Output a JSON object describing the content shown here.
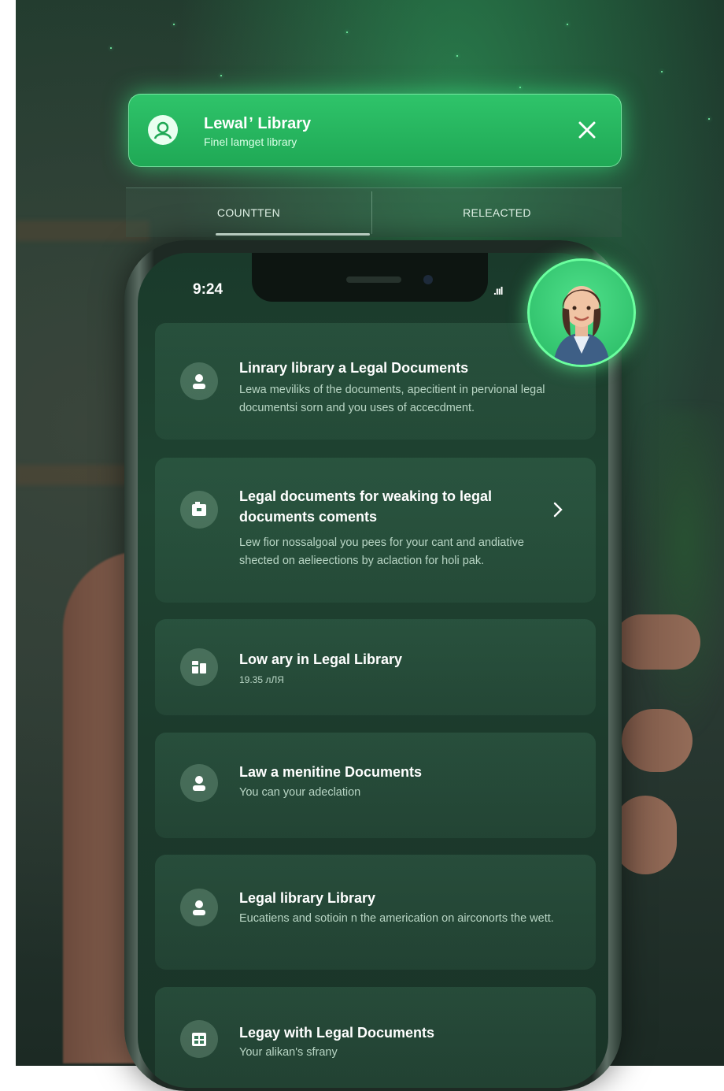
{
  "banner": {
    "title": "Lewal ʼ Library",
    "subtitle": "Finel lamget library",
    "icon": "user-icon",
    "close_icon": "close-icon"
  },
  "tabs": [
    {
      "label": "COUNTTEN",
      "active": true
    },
    {
      "label": "RELEACTED",
      "active": false
    }
  ],
  "status_bar": {
    "time": "9:24",
    "signal": ".ııl"
  },
  "cards": [
    {
      "title": "Linrary library a Legal Documents",
      "description": "Lewa meviliks of the documents, apecitient in pervional legal documentsi sorn and you uses of accecdment.",
      "icon": "person-icon"
    },
    {
      "title": "Legal documents for weaking to legal documents coments",
      "description": "Lew fior nossalgoal you pees for your cant and andiative shected on aelieections by aclaction for holi pak.",
      "icon": "folder-icon",
      "has_chevron": true
    },
    {
      "title": "Low ary in Legal Library",
      "description": "19.35 лЛЯ",
      "icon": "books-icon"
    },
    {
      "title": "Law a menitine Documents",
      "description": "You can your adeclation",
      "icon": "person-icon"
    },
    {
      "title": "Legal library Library",
      "description": "Eucatiens and sotioin n the americation on airconorts the wett.",
      "icon": "person-icon"
    },
    {
      "title": "Legay with Legal Documents",
      "description": "Your alikan's sfrany",
      "icon": "calendar-grid-icon"
    }
  ],
  "colors": {
    "accent": "#2fc46a",
    "glow": "#6bff9f",
    "card_text": "#ffffff",
    "card_subtext": "#b9d6c5"
  }
}
